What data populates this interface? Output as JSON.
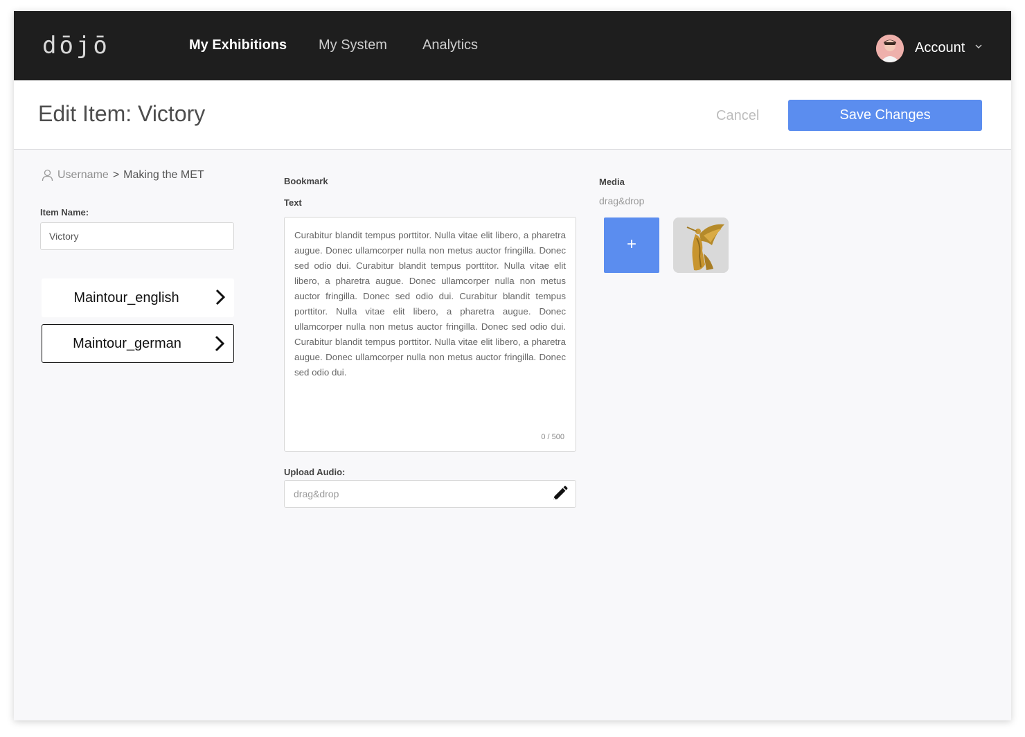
{
  "app": {
    "logo": "dōjō"
  },
  "nav": {
    "items": [
      "My Exhibitions",
      "My System",
      "Analytics"
    ],
    "account_label": "Account"
  },
  "header": {
    "title": "Edit Item: Victory",
    "cancel_label": "Cancel",
    "save_label": "Save Changes"
  },
  "breadcrumb": {
    "user": "Username",
    "separator": ">",
    "current": "Making the MET"
  },
  "item": {
    "name_label": "Item Name:",
    "name_value": "Victory"
  },
  "tours": [
    "Maintour_english",
    "Maintour_german"
  ],
  "bookmark": {
    "section_label": "Bookmark",
    "text_label": "Text",
    "text_value": "Curabitur blandit tempus porttitor. Nulla vitae elit libero, a pharetra augue. Donec ullamcorper nulla non metus auctor fringilla. Donec sed odio dui. Curabitur blandit tempus porttitor. Nulla vitae elit libero, a pharetra augue. Donec ullamcorper nulla non metus auctor fringilla. Donec sed odio dui. Curabitur blandit tempus porttitor. Nulla vitae elit libero, a pharetra augue. Donec ullamcorper nulla non metus auctor fringilla. Donec sed odio dui. Curabitur blandit tempus porttitor. Nulla vitae elit libero, a pharetra augue. Donec ullamcorper nulla non metus auctor fringilla. Donec sed odio dui.",
    "char_count": "0 / 500",
    "audio_label": "Upload Audio:",
    "audio_placeholder": "drag&drop"
  },
  "media": {
    "section_label": "Media",
    "hint": "drag&drop",
    "add_symbol": "+"
  },
  "colors": {
    "primary": "#5b8def",
    "nav_bg": "#1e1e1e",
    "page_bg": "#f8f8fa"
  },
  "icons": [
    "user-icon",
    "chevron-down-icon",
    "chevron-right-icon",
    "pencil-icon",
    "plus-icon"
  ]
}
